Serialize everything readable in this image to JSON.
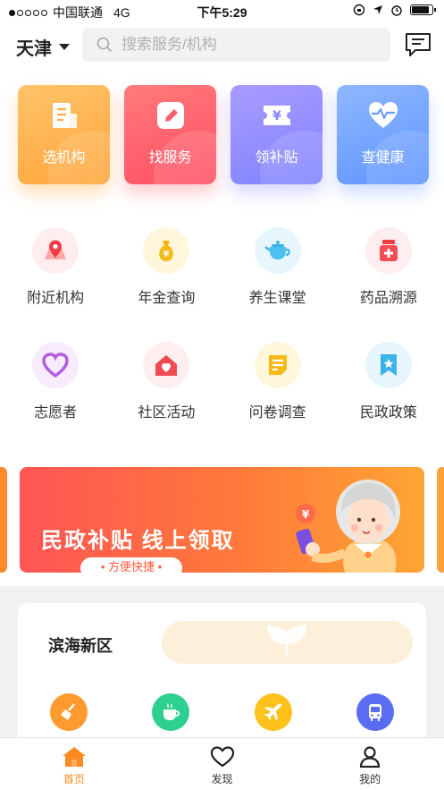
{
  "status_bar": {
    "carrier": "中国联通",
    "network": "4G",
    "time": "下午5:29"
  },
  "header": {
    "city": "天津",
    "search_placeholder": "搜索服务/机构"
  },
  "feature_cards": [
    {
      "label": "选机构",
      "icon": "building-icon"
    },
    {
      "label": "找服务",
      "icon": "pencil-icon"
    },
    {
      "label": "领补贴",
      "icon": "yuan-ticket-icon"
    },
    {
      "label": "查健康",
      "icon": "heartbeat-icon"
    }
  ],
  "services": [
    {
      "label": "附近机构",
      "icon": "map-pin-icon"
    },
    {
      "label": "年金查询",
      "icon": "money-bag-icon"
    },
    {
      "label": "养生课堂",
      "icon": "teapot-icon"
    },
    {
      "label": "药品溯源",
      "icon": "medicine-box-icon"
    },
    {
      "label": "志愿者",
      "icon": "heart-icon"
    },
    {
      "label": "社区活动",
      "icon": "house-heart-icon"
    },
    {
      "label": "问卷调查",
      "icon": "questionnaire-icon"
    },
    {
      "label": "民政政策",
      "icon": "bookmark-star-icon"
    }
  ],
  "banner": {
    "title": "民政补贴 线上领取",
    "tag": "• 方便快捷 •"
  },
  "region": {
    "name": "滨海新区",
    "items": [
      "broom-icon",
      "coffee-cup-icon",
      "airplane-icon",
      "bus-icon"
    ]
  },
  "tabbar": [
    {
      "label": "首页",
      "icon": "home-icon",
      "active": true
    },
    {
      "label": "发现",
      "icon": "heart-outline-icon",
      "active": false
    },
    {
      "label": "我的",
      "icon": "user-icon",
      "active": false
    }
  ],
  "colors": {
    "accent": "#ff8a22",
    "banner_start": "#ff5555",
    "banner_end": "#ffa534"
  }
}
